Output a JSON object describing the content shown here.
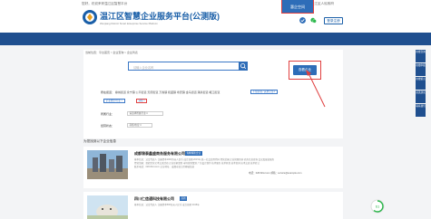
{
  "topbar": {
    "left": "您好，欢迎来到温江区智慧平台",
    "right": "成都市温江区人民政府"
  },
  "header": {
    "title": "温江区智慧企业服务平台",
    "title_suffix": "(公测版)",
    "subtitle": "Wenjiang District Smart Enterprise Service Platform",
    "login_label": "登录注册"
  },
  "nav": {
    "items": [
      {
        "label": "平台主页"
      },
      {
        "label": "资讯导航"
      },
      {
        "label": "公示公告"
      },
      {
        "label": "政策中心"
      },
      {
        "label": "政策兑现"
      },
      {
        "label": "营业服务"
      },
      {
        "label": "中介服务"
      },
      {
        "label": "惠企空间"
      },
      {
        "label": "个人中心 ▾"
      }
    ],
    "active_index": 7
  },
  "rail": {
    "items": [
      "在线咨询",
      "在线申报",
      "在线留言",
      "意见建议",
      "联系我们"
    ]
  },
  "breadcrumb": "当前位置：平台首页 > 企业查询 > 企业列表",
  "search": {
    "placeholder": "请输入企业名称",
    "button_icon": "search-icon",
    "advanced_label": "查看企业"
  },
  "filters": {
    "region_label": "所在街道：",
    "region_options": "柳城街道  永宁镇  公平街道  天府街道  万春镇  和盛镇  寿安镇  金马街道  涌泉街道  岷江街道",
    "region_tag": "不限区域 / 其他全部 ▾",
    "selected_tag_1": "企业类型/行业 ×",
    "selected_tag_2": "清除 ×",
    "industry_label": "所属行业：",
    "industry_value": "请选择所属行业 ▾",
    "status_label": "经营状态：",
    "status_value": "存续/在业 ▾"
  },
  "section_title": "为您找到以下企业信息",
  "companies": [
    {
      "name": "成都锦泰鑫盛商务服务有限公司",
      "badge": "专精特新企业",
      "line1": "基本信息：法定代表人 注册资本1000万元人民币 成立日期 2015年 统一社会信用代码 经营范围 企业管理咨询 商务信息咨询 会议及展览服务",
      "line2": "经营范围：组织文化艺术交流活动 企业形象策划 市场营销策划 广告设计制作 技术服务 技术开发 技术咨询 技术交流 技术转让",
      "line3": "联系电话：028-82xxxxxx  企业地址：成都市温江区柳城街道",
      "extra": "电话：028-82xxxxxx 邮箱：service@example.com"
    },
    {
      "name": "四川仁信通科技有限公司",
      "badge": "高新",
      "line1": "基本信息：法定代表人 注册资本500万元人民币 成立日期 2018年"
    }
  ],
  "gauge": {
    "value": "61",
    "unit": "%"
  },
  "colors": {
    "brand": "#1f4f8f",
    "accent": "#2e6db8",
    "highlight": "#e04040"
  }
}
